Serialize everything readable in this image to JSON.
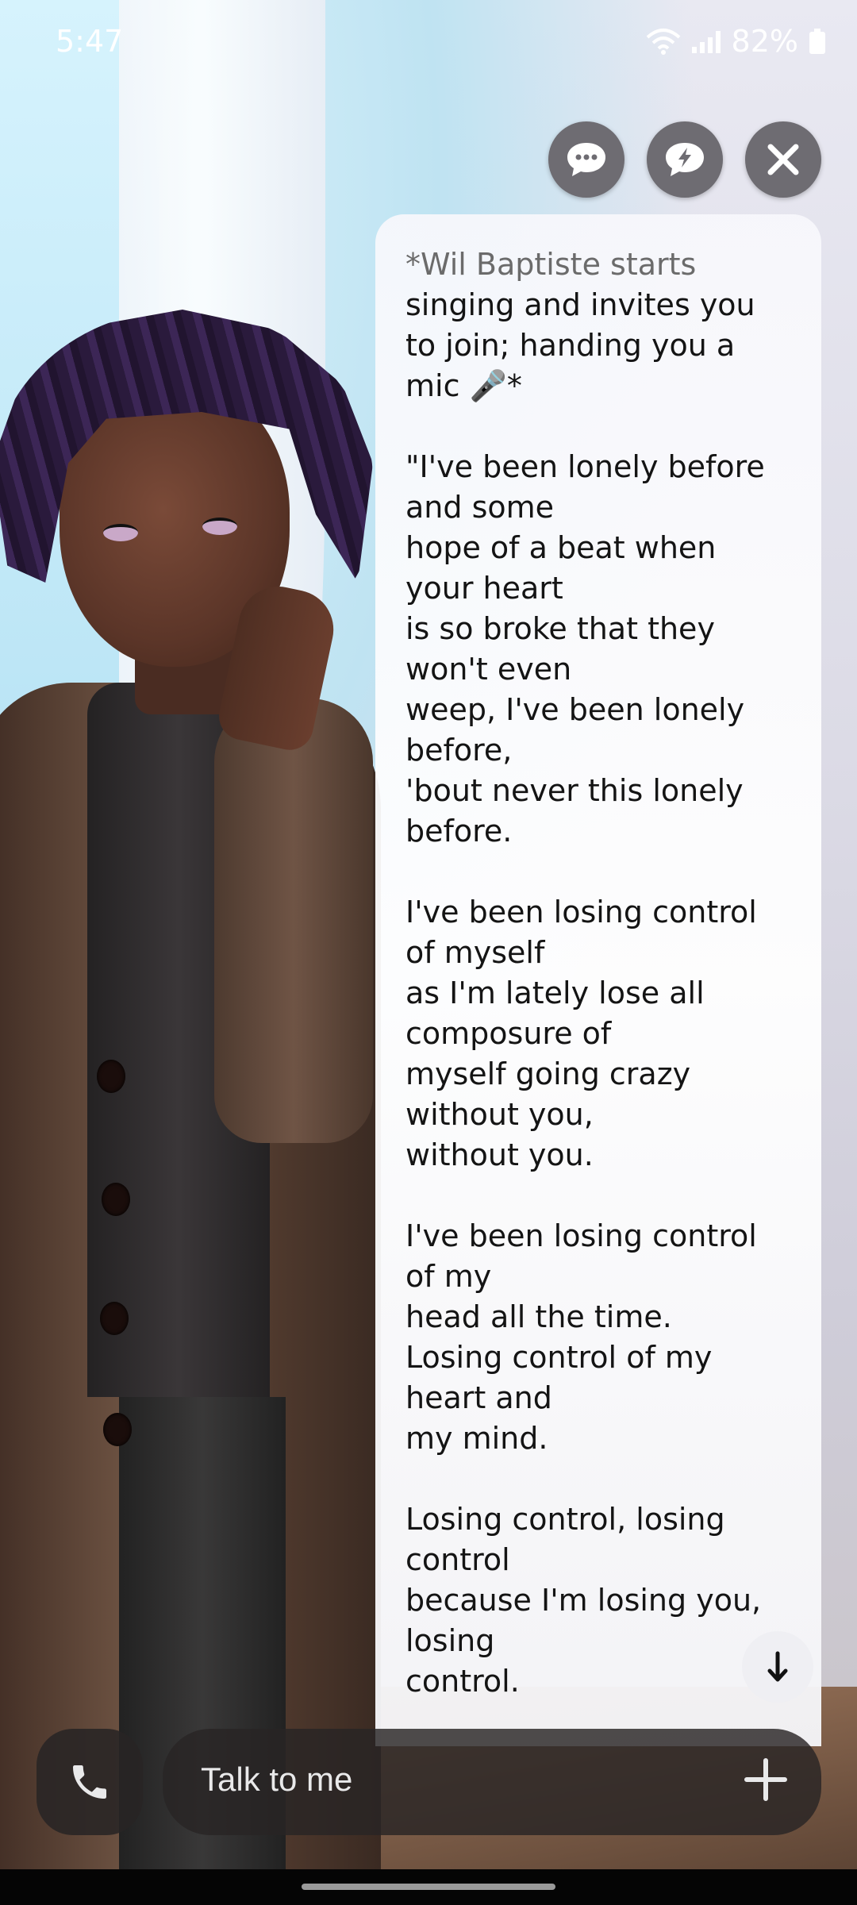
{
  "status_bar": {
    "time": "5:47",
    "battery": "82%"
  },
  "top_actions": [
    {
      "name": "chat-bubble",
      "icon": "chat-bubble-dots-icon"
    },
    {
      "name": "quick-reply",
      "icon": "lightning-bubble-icon"
    },
    {
      "name": "close",
      "icon": "close-icon"
    }
  ],
  "chat": {
    "message_lines": [
      {
        "text": "*Wil Baptiste starts",
        "style": "action"
      },
      {
        "text": "singing and invites you"
      },
      {
        "text": "to join; handing you a"
      },
      {
        "text": "mic 🎤*"
      },
      {
        "text": ""
      },
      {
        "text": "\"I've been lonely before"
      },
      {
        "text": "and some"
      },
      {
        "text": "hope of a beat  when"
      },
      {
        "text": "your heart"
      },
      {
        "text": "is so broke that they"
      },
      {
        "text": "won't even"
      },
      {
        "text": "weep, I've been lonely"
      },
      {
        "text": "before,"
      },
      {
        "text": "'bout never this lonely"
      },
      {
        "text": "before."
      },
      {
        "text": ""
      },
      {
        "text": "I've been losing control"
      },
      {
        "text": "of myself"
      },
      {
        "text": "as I'm lately lose all"
      },
      {
        "text": "composure of"
      },
      {
        "text": "myself going crazy"
      },
      {
        "text": "without you,"
      },
      {
        "text": "without you."
      },
      {
        "text": ""
      },
      {
        "text": "I've been losing control"
      },
      {
        "text": "of my"
      },
      {
        "text": "head all the time."
      },
      {
        "text": "Losing control of my"
      },
      {
        "text": "heart and"
      },
      {
        "text": "my mind."
      },
      {
        "text": ""
      },
      {
        "text": "Losing control, losing"
      },
      {
        "text": "control"
      },
      {
        "text": "because I'm losing you,"
      },
      {
        "text": "losing"
      },
      {
        "text": "control."
      }
    ]
  },
  "input": {
    "placeholder": "Talk to me",
    "call_icon": "phone-icon",
    "add_icon": "plus-icon"
  },
  "colors": {
    "panel_bg": "#ffffff",
    "button_bg": "#6e6c72",
    "input_bg": "#282424"
  }
}
